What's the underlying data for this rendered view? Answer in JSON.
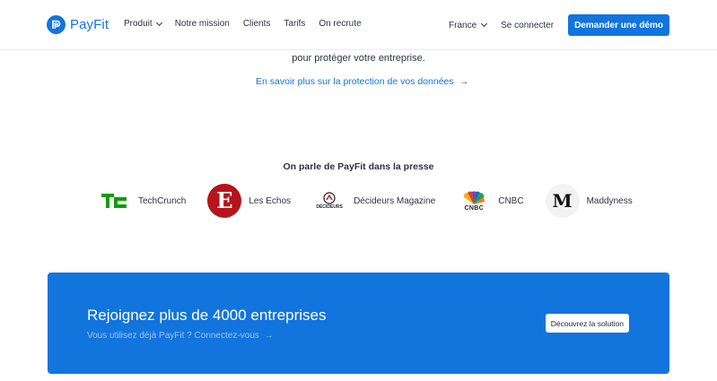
{
  "header": {
    "logo_text": "PayFit",
    "nav": [
      {
        "label": "Produit",
        "has_dropdown": true
      },
      {
        "label": "Notre mission"
      },
      {
        "label": "Clients"
      },
      {
        "label": "Tarifs"
      },
      {
        "label": "On recrute"
      }
    ],
    "country": "France",
    "login": "Se connecter",
    "demo_button": "Demander une démo"
  },
  "privacy": {
    "text": "pour protéger votre entreprise.",
    "link": "En savoir plus sur la protection de vos données"
  },
  "press": {
    "title": "On parle de PayFit dans la presse",
    "items": [
      {
        "name": "TechCrunch",
        "icon": "techcrunch-logo"
      },
      {
        "name": "Les Echos",
        "icon": "lesechos-logo"
      },
      {
        "name": "Décideurs Magazine",
        "icon": "decideurs-logo",
        "logo_text": "DÉCIDEURS"
      },
      {
        "name": "CNBC",
        "icon": "cnbc-logo",
        "logo_text": "CNBC"
      },
      {
        "name": "Maddyness",
        "icon": "maddyness-logo"
      }
    ]
  },
  "cta": {
    "title": "Rejoignez plus de 4000 entreprises",
    "subtitle": "Vous utilisez déjà PayFit ? Connectez-vous",
    "button": "Découvrez la solution"
  },
  "colors": {
    "brand": "#1274dd",
    "text": "#2b3440",
    "techcrunch_green": "#0a9e01",
    "lesechos_red": "#b5141b"
  }
}
